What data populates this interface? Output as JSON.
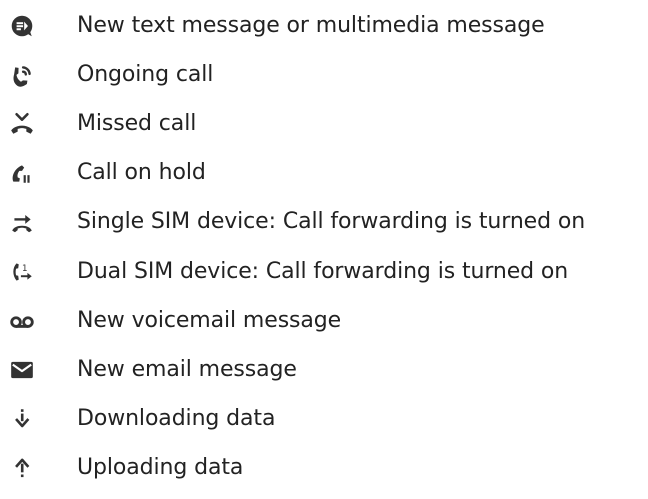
{
  "icon_color": "#333333",
  "items": [
    {
      "icon": "message-icon",
      "label": "New text message or multimedia message"
    },
    {
      "icon": "ongoing-call-icon",
      "label": "Ongoing call"
    },
    {
      "icon": "missed-call-icon",
      "label": "Missed call"
    },
    {
      "icon": "call-on-hold-icon",
      "label": "Call on hold"
    },
    {
      "icon": "call-forwarding-icon",
      "label": "Single SIM device: Call forwarding is turned on"
    },
    {
      "icon": "dual-sim-call-forwarding-icon",
      "label": "Dual SIM device: Call forwarding is turned on"
    },
    {
      "icon": "voicemail-icon",
      "label": "New voicemail message"
    },
    {
      "icon": "email-icon",
      "label": "New email message"
    },
    {
      "icon": "download-icon",
      "label": "Downloading data"
    },
    {
      "icon": "upload-icon",
      "label": "Uploading data"
    }
  ]
}
